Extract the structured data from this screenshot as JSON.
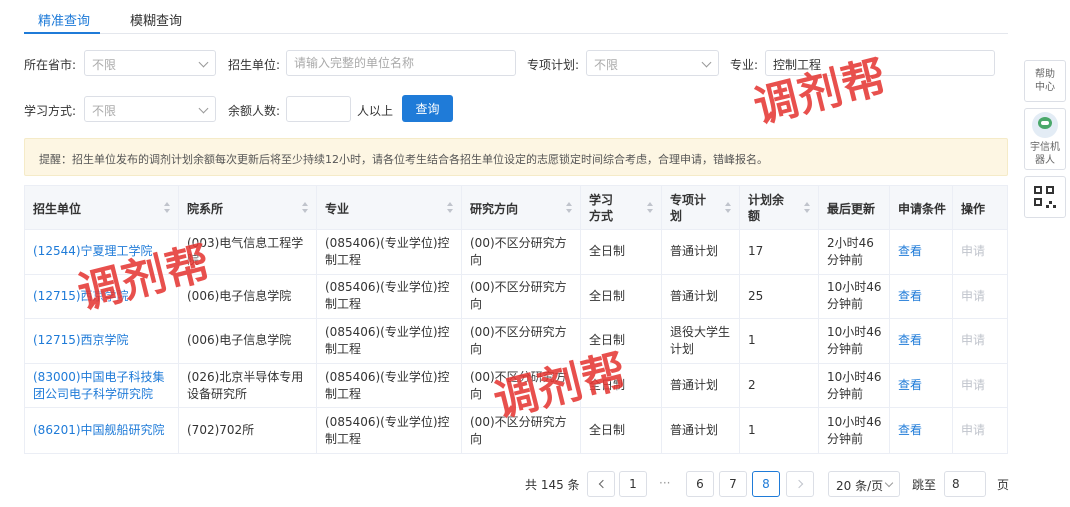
{
  "tabs": [
    {
      "label": "精准查询",
      "active": true
    },
    {
      "label": "模糊查询",
      "active": false
    }
  ],
  "filters": {
    "province": {
      "label": "所在省市:",
      "value": "不限"
    },
    "unit": {
      "label": "招生单位:",
      "placeholder": "请输入完整的单位名称"
    },
    "special_plan": {
      "label": "专项计划:",
      "value": "不限"
    },
    "major": {
      "label": "专业:",
      "value": "控制工程"
    },
    "study_mode": {
      "label": "学习方式:",
      "value": "不限"
    },
    "remaining": {
      "label": "余额人数:",
      "value": "",
      "suffix": "人以上"
    },
    "query_button": "查询"
  },
  "notice": "提醒：招生单位发布的调剂计划余额每次更新后将至少持续12小时，请各位考生结合各招生单位设定的志愿锁定时间综合考虑，合理申请，错峰报名。",
  "table": {
    "headers": [
      "招生单位",
      "院系所",
      "专业",
      "研究方向",
      "学习方式",
      "专项计划",
      "计划余额",
      "最后更新",
      "申请条件",
      "操作"
    ],
    "rows": [
      {
        "unit": "(12544)宁夏理工学院",
        "dept": "(003)电气信息工程学院",
        "major": "(085406)(专业学位)控制工程",
        "direction": "(00)不区分研究方向",
        "mode": "全日制",
        "plan": "普通计划",
        "remaining": "17",
        "updated": "2小时46分钟前",
        "cond": "查看",
        "action": "申请"
      },
      {
        "unit": "(12715)西京学院",
        "dept": "(006)电子信息学院",
        "major": "(085406)(专业学位)控制工程",
        "direction": "(00)不区分研究方向",
        "mode": "全日制",
        "plan": "普通计划",
        "remaining": "25",
        "updated": "10小时46分钟前",
        "cond": "查看",
        "action": "申请"
      },
      {
        "unit": "(12715)西京学院",
        "dept": "(006)电子信息学院",
        "major": "(085406)(专业学位)控制工程",
        "direction": "(00)不区分研究方向",
        "mode": "全日制",
        "plan": "退役大学生计划",
        "remaining": "1",
        "updated": "10小时46分钟前",
        "cond": "查看",
        "action": "申请"
      },
      {
        "unit": "(83000)中国电子科技集团公司电子科学研究院",
        "dept": "(026)北京半导体专用设备研究所",
        "major": "(085406)(专业学位)控制工程",
        "direction": "(00)不区分研究方向",
        "mode": "全日制",
        "plan": "普通计划",
        "remaining": "2",
        "updated": "10小时46分钟前",
        "cond": "查看",
        "action": "申请"
      },
      {
        "unit": "(86201)中国舰船研究院",
        "dept": "(702)702所",
        "major": "(085406)(专业学位)控制工程",
        "direction": "(00)不区分研究方向",
        "mode": "全日制",
        "plan": "普通计划",
        "remaining": "1",
        "updated": "10小时46分钟前",
        "cond": "查看",
        "action": "申请"
      }
    ]
  },
  "pagination": {
    "total": "共 145 条",
    "pages": [
      "1",
      "6",
      "7",
      "8"
    ],
    "ellipsis": "···",
    "current": "8",
    "page_size": "20 条/页",
    "jump_label": "跳至",
    "jump_value": "8",
    "jump_suffix": "页"
  },
  "sidebar": {
    "help": "帮助中心",
    "robot": "宇信机器人"
  },
  "watermark": "调剂帮",
  "colors": {
    "accent": "#1f7bd8",
    "watermark": "#e53935",
    "notice_bg": "#fdf6e3"
  }
}
